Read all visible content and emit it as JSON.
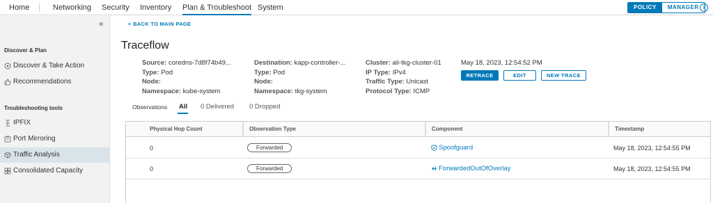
{
  "topnav": {
    "items": [
      "Home",
      "Networking",
      "Security",
      "Inventory",
      "Plan & Troubleshoot",
      "System"
    ],
    "active": "Plan & Troubleshoot",
    "mode": {
      "policy": "POLICY",
      "manager": "MANAGER",
      "active": "POLICY"
    },
    "help_icon": "info-icon"
  },
  "sidebar": {
    "collapse_icon": "double-chevron-left-icon",
    "sections": [
      {
        "heading": "Discover & Plan",
        "items": [
          {
            "label": "Discover & Take Action",
            "icon": "discover-icon"
          },
          {
            "label": "Recommendations",
            "icon": "thumbs-up-icon"
          }
        ]
      },
      {
        "heading": "Troubleshooting tools",
        "items": [
          {
            "label": "IPFIX",
            "icon": "ipfix-icon"
          },
          {
            "label": "Port Mirroring",
            "icon": "port-mirroring-icon"
          },
          {
            "label": "Traffic Analysis",
            "icon": "traffic-analysis-icon",
            "active": true
          },
          {
            "label": "Consolidated Capacity",
            "icon": "capacity-icon"
          }
        ]
      }
    ]
  },
  "main": {
    "back_link": "BACK TO MAIN PAGE",
    "title": "Traceflow",
    "source": {
      "label": "Source:",
      "value": "coredns-7d8f74b49..."
    },
    "source_type": {
      "label": "Type:",
      "value": "Pod"
    },
    "source_node": {
      "label": "Node:",
      "value": ""
    },
    "source_ns": {
      "label": "Namespace:",
      "value": "kube-system"
    },
    "dest": {
      "label": "Destination:",
      "value": "kapp-controller-..."
    },
    "dest_type": {
      "label": "Type:",
      "value": "Pod"
    },
    "dest_node": {
      "label": "Node:",
      "value": ""
    },
    "dest_ns": {
      "label": "Namespace:",
      "value": "tkg-system"
    },
    "cluster": {
      "label": "Cluster:",
      "value": "ali-tkg-cluster-01"
    },
    "ip_type": {
      "label": "IP Type:",
      "value": "IPv4"
    },
    "traffic_type": {
      "label": "Traffic Type:",
      "value": "Unicast"
    },
    "protocol_type": {
      "label": "Protocol Type:",
      "value": "ICMP"
    },
    "timestamp": "May 18, 2023, 12:54:52 PM",
    "buttons": {
      "retrace": "RETRACE",
      "edit": "EDIT",
      "new_trace": "NEW TRACE"
    },
    "tabs": {
      "observations": "Observations",
      "all": "All",
      "delivered": "0 Delivered",
      "dropped": "0 Dropped"
    },
    "table": {
      "headers": [
        "Physical Hop Count",
        "Observation Type",
        "Component",
        "Timestamp"
      ],
      "rows": [
        {
          "hop": "0",
          "type": "Forwarded",
          "component": "Spoofguard",
          "component_icon": "shield-icon",
          "timestamp": "May 18, 2023, 12:54:55 PM"
        },
        {
          "hop": "0",
          "type": "Forwarded",
          "component": "ForwardedOutOfOverlay",
          "component_icon": "arrow-out-icon",
          "timestamp": "May 18, 2023, 12:54:55 PM"
        }
      ]
    }
  },
  "colors": {
    "accent": "#0079b8",
    "sidebar_bg": "#f2f2f2",
    "active_item": "#d9e4ea"
  }
}
